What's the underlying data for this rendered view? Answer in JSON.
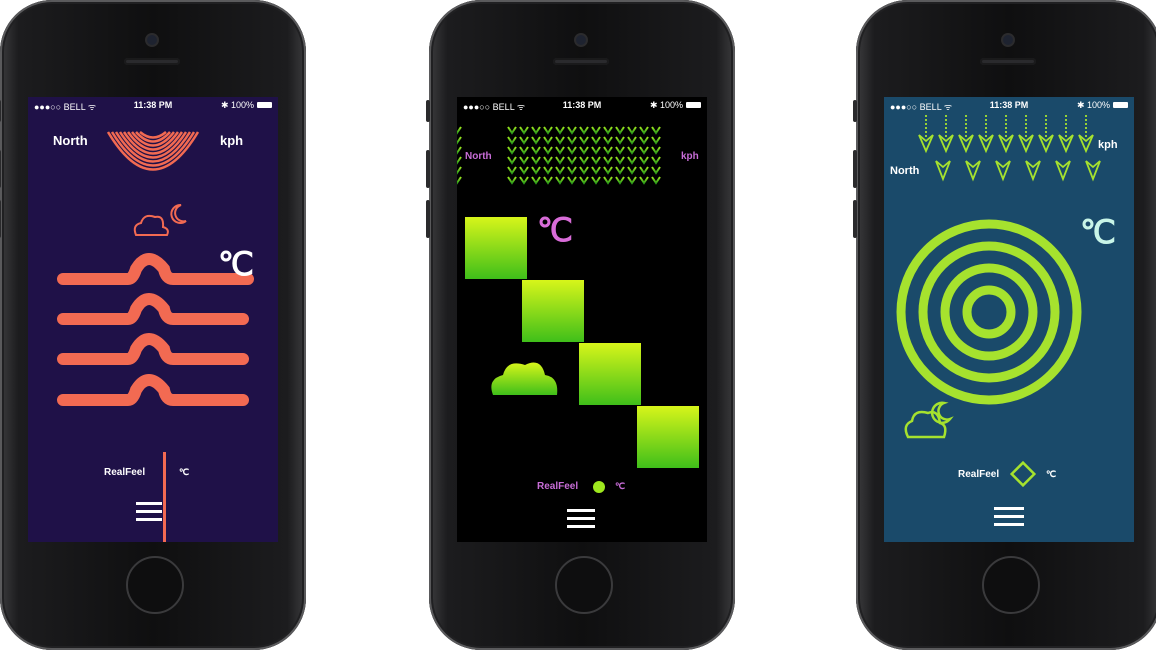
{
  "status_bar": {
    "carrier": "●●●○○ BELL ᯤ",
    "time": "11:38 PM",
    "battery": "✱ 100%"
  },
  "phones": [
    {
      "theme": "coral-waves",
      "screen_bg": "#1f1148",
      "accent": "#f26a52",
      "text_color": "#ffffff",
      "wind_direction": "North",
      "wind_unit": "kph",
      "temp_unit": "℃",
      "realfeel_label": "RealFeel",
      "realfeel_unit": "℃",
      "weather_icon": "cloud-moon-icon",
      "menu_icon": "hamburger-menu-icon"
    },
    {
      "theme": "neon-squares",
      "screen_bg": "#000000",
      "accent": "#7ad61c",
      "text_color": "#c86dd7",
      "wind_direction": "North",
      "wind_unit": "kph",
      "temp_unit": "℃",
      "realfeel_label": "RealFeel",
      "realfeel_unit": "℃",
      "weather_icon": "cloud-moon-icon",
      "menu_icon": "hamburger-menu-icon"
    },
    {
      "theme": "lime-rings",
      "screen_bg": "#1a4a6a",
      "accent": "#a6e22e",
      "text_color": "#ffffff",
      "wind_direction": "North",
      "wind_unit": "kph",
      "temp_unit": "℃",
      "realfeel_label": "RealFeel",
      "realfeel_unit": "℃",
      "weather_icon": "cloud-moon-icon",
      "menu_icon": "hamburger-menu-icon"
    }
  ]
}
